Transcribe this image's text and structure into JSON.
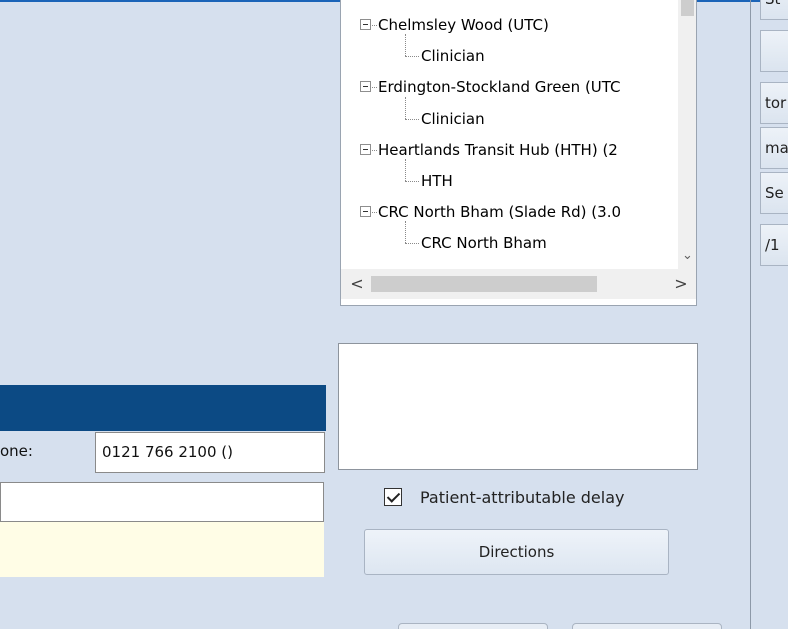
{
  "tree": {
    "nodes": [
      {
        "label": "Chelmsley Wood (UTC)",
        "level": 0,
        "expanded": true
      },
      {
        "label": "Clinician",
        "level": 1
      },
      {
        "label": "Erdington-Stockland Green (UTC",
        "level": 0,
        "expanded": true
      },
      {
        "label": "Clinician",
        "level": 1
      },
      {
        "label": "Heartlands Transit Hub (HTH) (2",
        "level": 0,
        "expanded": true
      },
      {
        "label": "HTH",
        "level": 1
      },
      {
        "label": "CRC North Bham (Slade Rd) (3.0",
        "level": 0,
        "expanded": true
      },
      {
        "label": "CRC North Bham",
        "level": 1
      }
    ]
  },
  "scroll": {
    "down_glyph": "⌄",
    "left_glyph": "<",
    "right_glyph": ">"
  },
  "form": {
    "phone_label": "one:",
    "phone_value": "0121 766 2100 ()"
  },
  "delay": {
    "label": "Patient-attributable delay",
    "checked": true
  },
  "directions_label": "Directions",
  "right_column": [
    "St",
    "",
    "tor",
    "ma",
    "Se",
    "/1"
  ],
  "colors": {
    "header_blue": "#0c4a84",
    "background": "#d6e0ee",
    "yellow_panel": "#fffde6"
  }
}
